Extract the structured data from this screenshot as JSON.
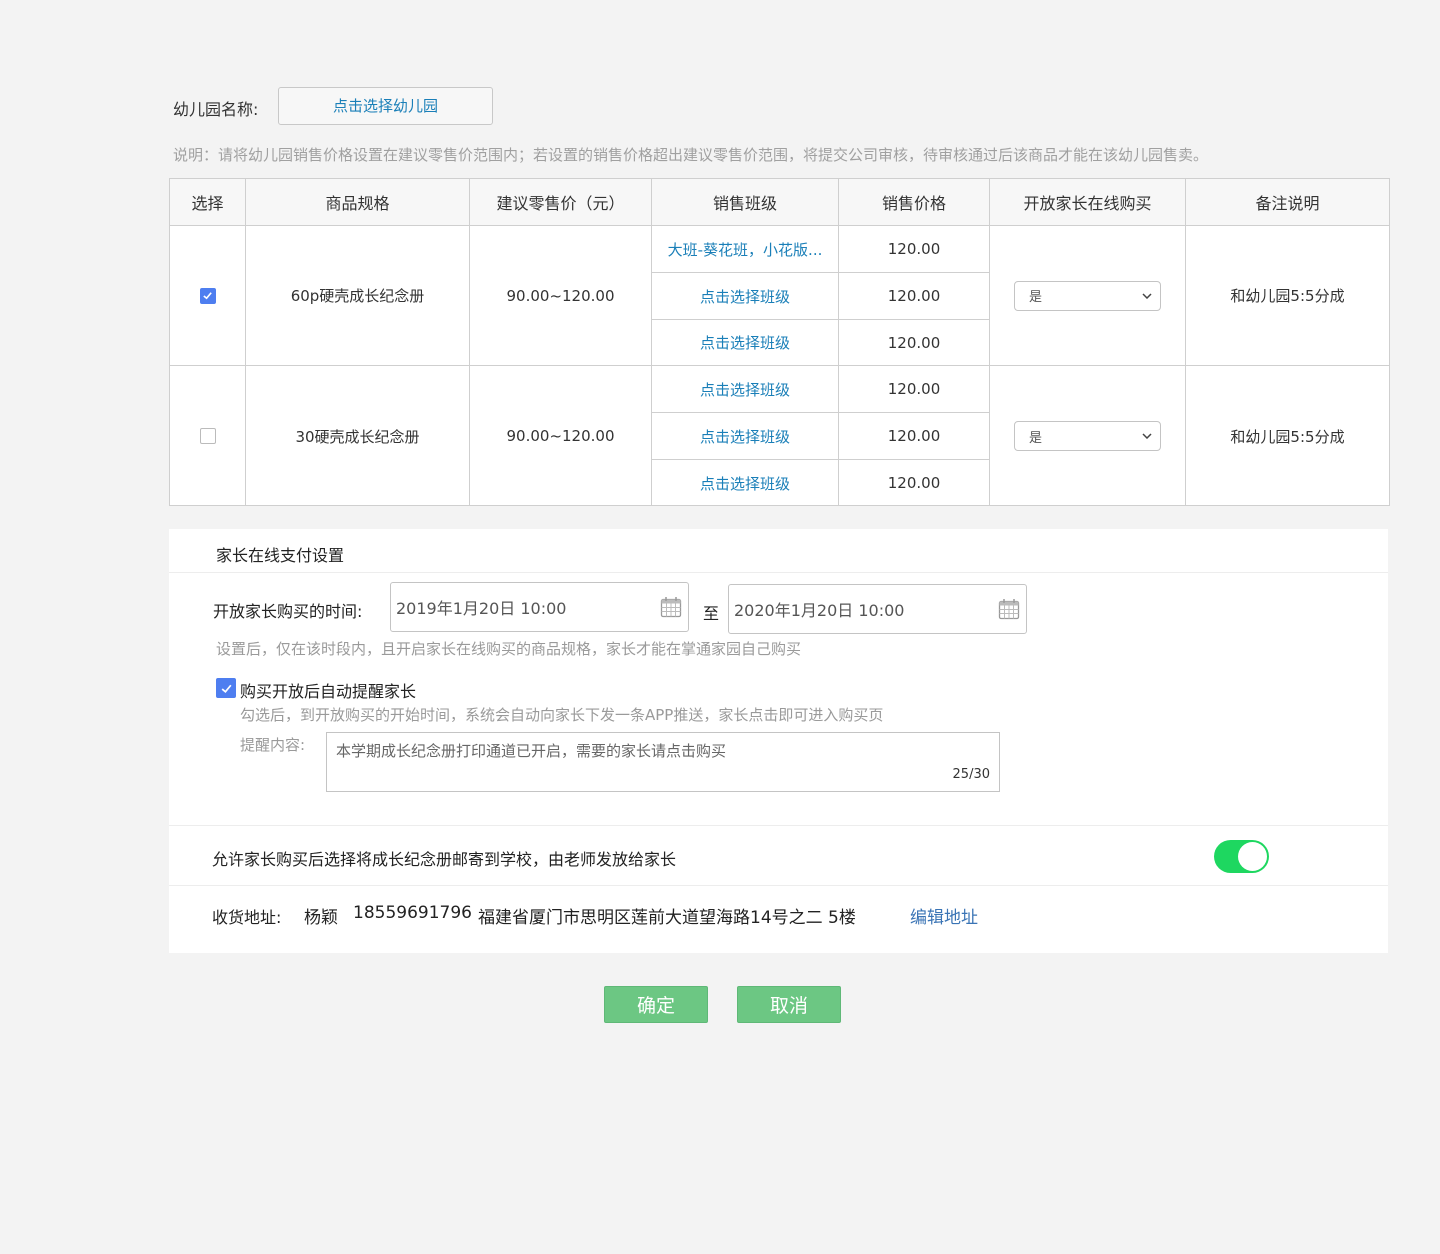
{
  "kindergarten": {
    "label": "幼儿园名称:",
    "button": "点击选择幼儿园"
  },
  "note": "说明：请将幼儿园销售价格设置在建议零售价范围内；若设置的销售价格超出建议零售价范围，将提交公司审核，待审核通过后该商品才能在该幼儿园售卖。",
  "table": {
    "headers": [
      "选择",
      "商品规格",
      "建议零售价（元）",
      "销售班级",
      "销售价格",
      "开放家长在线购买",
      "备注说明"
    ],
    "rows": [
      {
        "checked": true,
        "spec": "60p硬壳成长纪念册",
        "suggested_price": "90.00~120.00",
        "classes": [
          {
            "label": "大班-葵花班，小花版...",
            "price": "120.00"
          },
          {
            "label": "点击选择班级",
            "price": "120.00"
          },
          {
            "label": "点击选择班级",
            "price": "120.00"
          }
        ],
        "open_online": "是",
        "remark": "和幼儿园5:5分成"
      },
      {
        "checked": false,
        "spec": "30硬壳成长纪念册",
        "suggested_price": "90.00~120.00",
        "classes": [
          {
            "label": "点击选择班级",
            "price": "120.00"
          },
          {
            "label": "点击选择班级",
            "price": "120.00"
          },
          {
            "label": "点击选择班级",
            "price": "120.00"
          }
        ],
        "open_online": "是",
        "remark": "和幼儿园5:5分成"
      }
    ]
  },
  "payment": {
    "title": "家长在线支付设置",
    "time_label": "开放家长购买的时间:",
    "start_date": "2019年1月20日 10:00",
    "to": "至",
    "end_date": "2020年1月20日 10:00",
    "time_hint": "设置后，仅在该时段内，且开启家长在线购买的商品规格，家长才能在掌通家园自己购买",
    "remind_checked": true,
    "remind_label": "购买开放后自动提醒家长",
    "remind_hint": "勾选后，到开放购买的开始时间，系统会自动向家长下发一条APP推送，家长点击即可进入购买页",
    "content_label": "提醒内容:",
    "content_value": "本学期成长纪念册打印通道已开启，需要的家长请点击购买",
    "counter": "25/30",
    "mail_label": "允许家长购买后选择将成长纪念册邮寄到学校，由老师发放给家长",
    "mail_enabled": true,
    "address_label": "收货地址:",
    "address_name": "杨颖",
    "address_phone": "18559691796",
    "address_detail": "福建省厦门市思明区莲前大道望海路14号之二 5楼",
    "edit_address": "编辑地址"
  },
  "actions": {
    "confirm": "确定",
    "cancel": "取消"
  },
  "colors": {
    "link": "#1a7fb8",
    "primary_button": "#6cc783",
    "toggle_on": "#1ed760",
    "checkbox": "#4e7ef0"
  }
}
